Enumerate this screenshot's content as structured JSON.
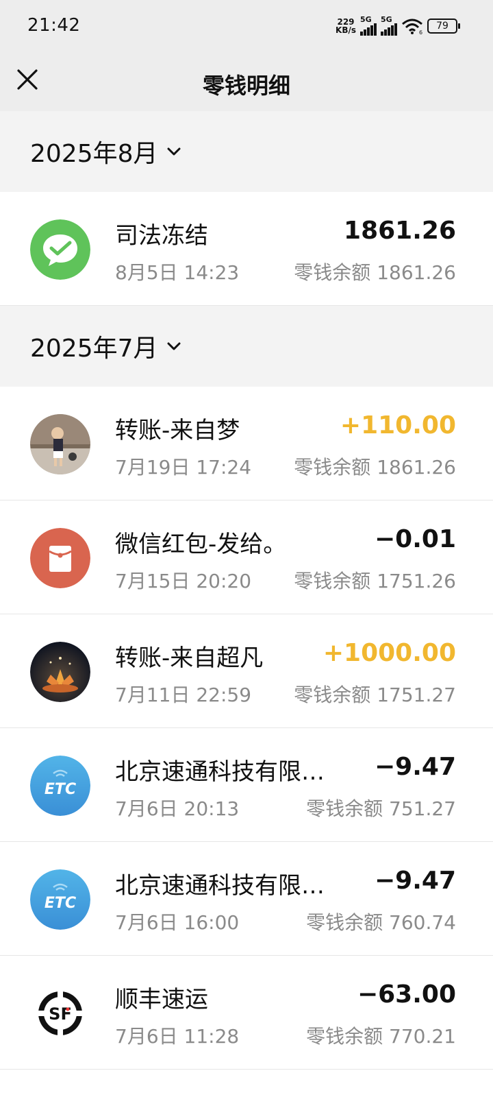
{
  "status_bar": {
    "time": "21:42",
    "net_speed_value": "229",
    "net_speed_unit": "KB/s",
    "signal1_label": "5G",
    "signal2_label": "5G",
    "wifi_badge": "6",
    "battery": "79"
  },
  "nav": {
    "title": "零钱明细",
    "close_icon": "close-icon"
  },
  "sections": [
    {
      "month": "2025年8月",
      "transactions": [
        {
          "title": "司法冻结",
          "time": "8月5日 14:23",
          "amount": "1861.26",
          "balance": "零钱余额 1861.26",
          "avatar": "wechat-pay-icon"
        }
      ]
    },
    {
      "month": "2025年7月",
      "transactions": [
        {
          "title": "转账-来自梦",
          "time": "7月19日 17:24",
          "amount": "+110.00",
          "balance": "零钱余额 1861.26",
          "avatar": "user-avatar-child"
        },
        {
          "title": "微信红包-发给。",
          "time": "7月15日 20:20",
          "amount": "−0.01",
          "balance": "零钱余额 1751.26",
          "avatar": "red-packet-icon"
        },
        {
          "title": "转账-来自超凡",
          "time": "7月11日 22:59",
          "amount": "+1000.00",
          "balance": "零钱余额 1751.27",
          "avatar": "user-avatar-lotus"
        },
        {
          "title": "北京速通科技有限…",
          "time": "7月6日 20:13",
          "amount": "−9.47",
          "balance": "零钱余额 751.27",
          "avatar": "etc-icon"
        },
        {
          "title": "北京速通科技有限…",
          "time": "7月6日 16:00",
          "amount": "−9.47",
          "balance": "零钱余额 760.74",
          "avatar": "etc-icon"
        },
        {
          "title": "顺丰速运",
          "time": "7月6日 11:28",
          "amount": "−63.00",
          "balance": "零钱余额 770.21",
          "avatar": "sf-express-icon"
        }
      ]
    }
  ],
  "colors": {
    "income": "#f1b72f",
    "wechat_green": "#5fc35a",
    "red_packet": "#d9654f",
    "etc_blue": "#4aa6e0"
  }
}
